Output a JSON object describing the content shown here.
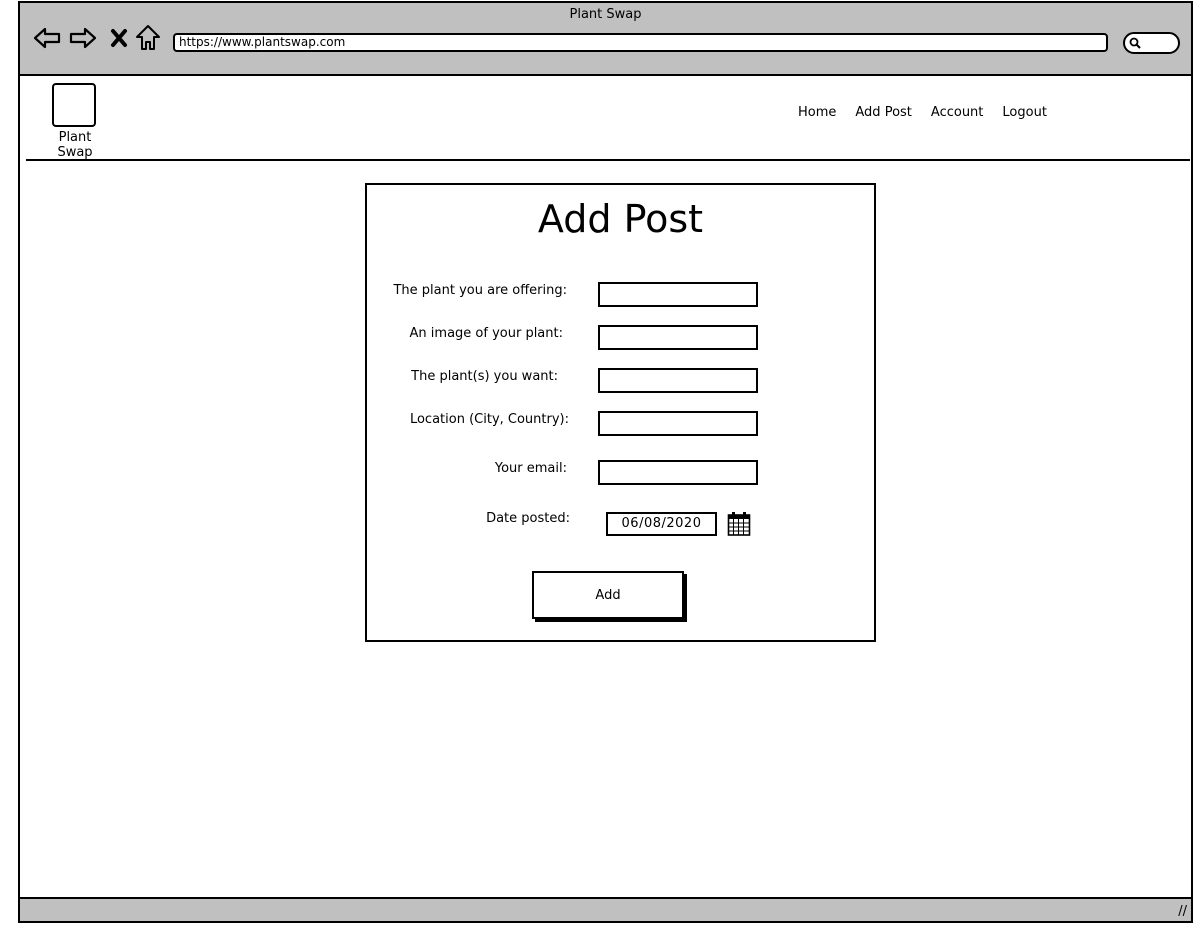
{
  "browser": {
    "window_title": "Plant Swap",
    "url": "https://www.plantswap.com",
    "nav_icons": [
      "back-arrow-icon",
      "forward-arrow-icon",
      "stop-icon",
      "home-icon"
    ],
    "search_icon": "search-icon"
  },
  "site": {
    "logo_label": "Plant Swap",
    "nav": [
      "Home",
      "Add Post",
      "Account",
      "Logout"
    ]
  },
  "form": {
    "title": "Add Post",
    "fields": [
      {
        "label": "The plant you are offering:",
        "value": ""
      },
      {
        "label": "An image of your plant:",
        "value": ""
      },
      {
        "label": "The plant(s) you want:",
        "value": ""
      },
      {
        "label": "Location (City, Country):",
        "value": ""
      },
      {
        "label": "Your email:",
        "value": ""
      }
    ],
    "date": {
      "label": "Date posted:",
      "value": "06/08/2020",
      "icon": "calendar-icon"
    },
    "submit_label": "Add"
  }
}
